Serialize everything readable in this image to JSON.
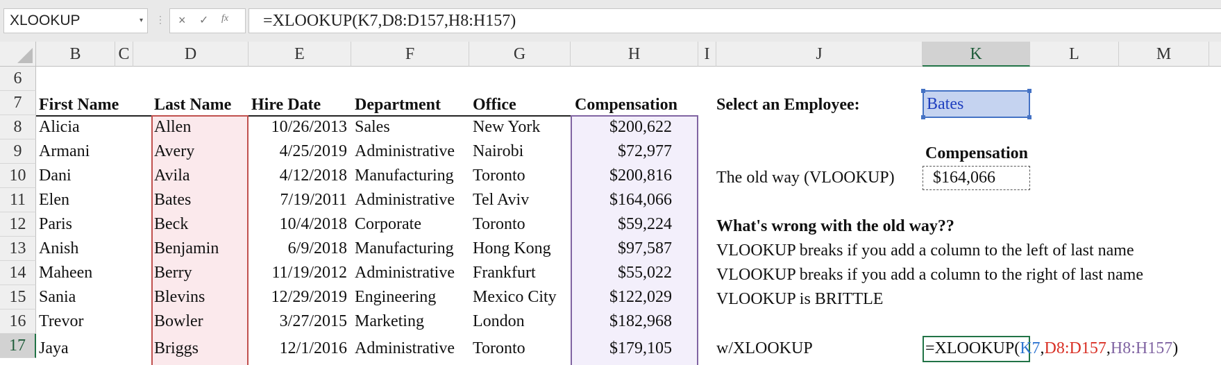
{
  "namebox": {
    "value": "XLOOKUP"
  },
  "formula_bar": {
    "cancel_icon": "×",
    "enter_icon": "✓",
    "fx_icon": "fx",
    "content": "=XLOOKUP(K7,D8:D157,H8:H157)"
  },
  "columns": [
    "B",
    "C",
    "D",
    "E",
    "F",
    "G",
    "H",
    "I",
    "J",
    "K",
    "L",
    "M"
  ],
  "rows": [
    "6",
    "7",
    "8",
    "9",
    "10",
    "11",
    "12",
    "13",
    "14",
    "15",
    "16",
    "17"
  ],
  "headers": {
    "first": "First Name",
    "last": "Last Name",
    "hire": "Hire Date",
    "dept": "Department",
    "office": "Office",
    "comp": "Compensation"
  },
  "employees": [
    {
      "first": "Alicia",
      "last": "Allen",
      "hire": "10/26/2013",
      "dept": "Sales",
      "office": "New York",
      "comp": "$200,622"
    },
    {
      "first": "Armani",
      "last": "Avery",
      "hire": "4/25/2019",
      "dept": "Administrative",
      "office": "Nairobi",
      "comp": "$72,977"
    },
    {
      "first": "Dani",
      "last": "Avila",
      "hire": "4/12/2018",
      "dept": "Manufacturing",
      "office": "Toronto",
      "comp": "$200,816"
    },
    {
      "first": "Elen",
      "last": "Bates",
      "hire": "7/19/2011",
      "dept": "Administrative",
      "office": "Tel Aviv",
      "comp": "$164,066"
    },
    {
      "first": "Paris",
      "last": "Beck",
      "hire": "10/4/2018",
      "dept": "Corporate",
      "office": "Toronto",
      "comp": "$59,224"
    },
    {
      "first": "Anish",
      "last": "Benjamin",
      "hire": "6/9/2018",
      "dept": "Manufacturing",
      "office": "Hong Kong",
      "comp": "$97,587"
    },
    {
      "first": "Maheen",
      "last": "Berry",
      "hire": "11/19/2012",
      "dept": "Administrative",
      "office": "Frankfurt",
      "comp": "$55,022"
    },
    {
      "first": "Sania",
      "last": "Blevins",
      "hire": "12/29/2019",
      "dept": "Engineering",
      "office": "Mexico City",
      "comp": "$122,029"
    },
    {
      "first": "Trevor",
      "last": "Bowler",
      "hire": "3/27/2015",
      "dept": "Marketing",
      "office": "London",
      "comp": "$182,968"
    },
    {
      "first": "Jaya",
      "last": "Briggs",
      "hire": "12/1/2016",
      "dept": "Administrative",
      "office": "Toronto",
      "comp": "$179,105"
    }
  ],
  "side": {
    "select_label": "Select an Employee:",
    "selected_name": "Bates",
    "comp_header": "Compensation",
    "old_way_label": "The old way (VLOOKUP)",
    "old_way_value": "$164,066",
    "wrong_title": "What's wrong with the old way??",
    "note1": "VLOOKUP breaks if you add a column to the left of last name",
    "note2": "VLOOKUP breaks if you add a column to the right of last name",
    "note3": "VLOOKUP is BRITTLE",
    "xlookup_label": "w/XLOOKUP",
    "xlookup_edit": {
      "fn": "=XLOOKUP(",
      "ref1": "K7",
      "sep1": ",",
      "ref2": "D8:D157",
      "sep2": ",",
      "ref3": "H8:H157",
      "close": ")"
    }
  },
  "colors": {
    "accent": "#217346",
    "ref_blue": "#2e75d0",
    "ref_red": "#d93025",
    "ref_purple": "#8064a2"
  }
}
